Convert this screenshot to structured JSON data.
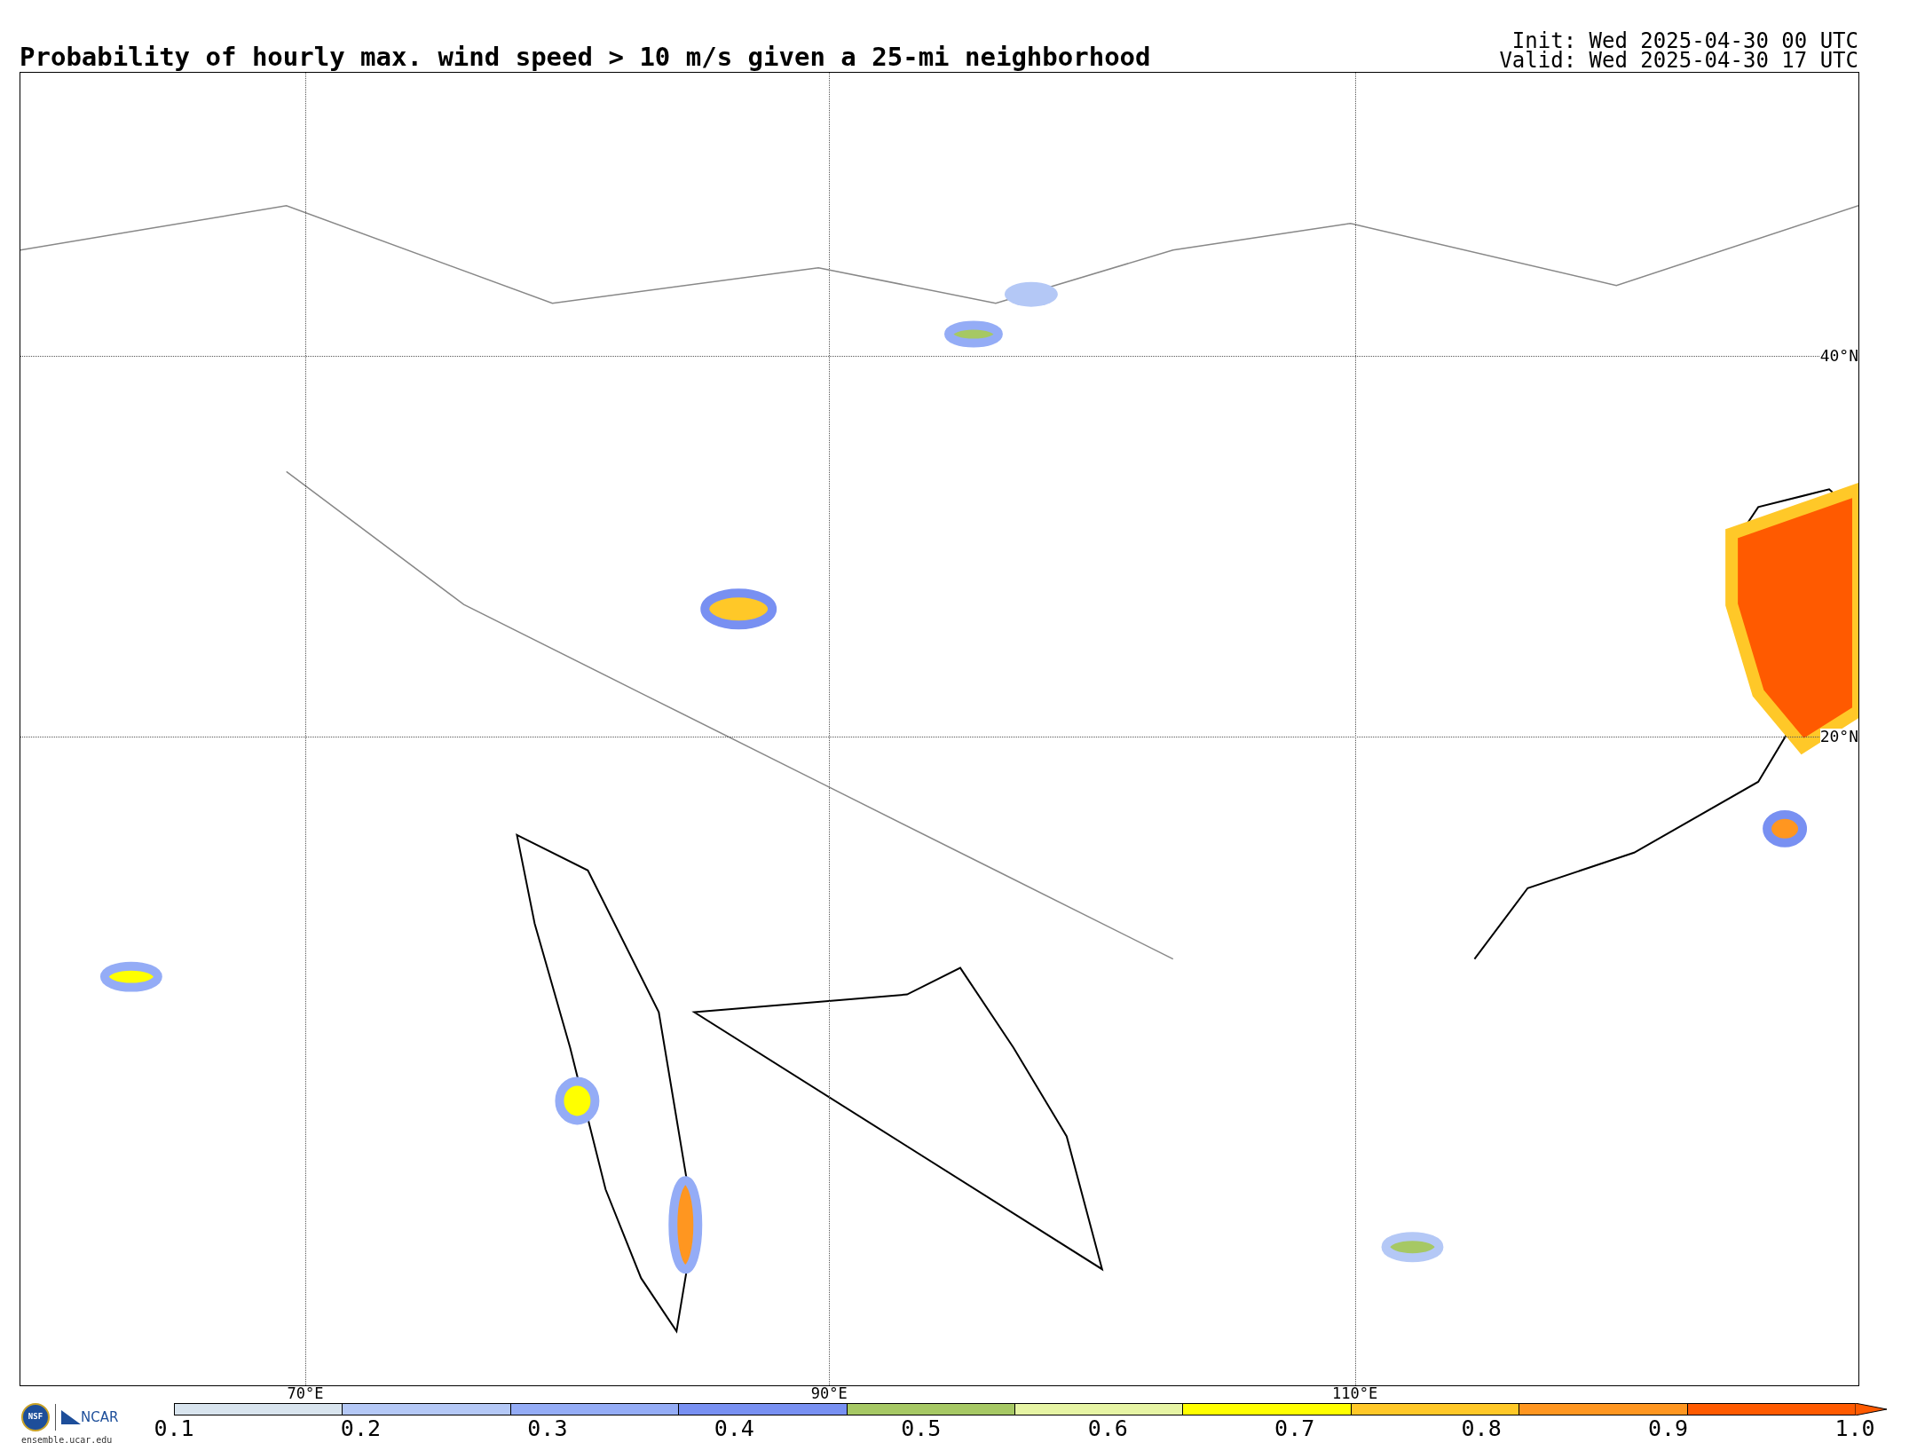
{
  "title": "Probability of hourly max. wind speed > 10 m/s given a 25-mi neighborhood",
  "run_info": [
    "Init: Wed 2025-04-30 00 UTC",
    "Valid: Wed 2025-04-30 17 UTC"
  ],
  "map": {
    "lon_labels": [
      "70°E",
      "90°E",
      "110°E"
    ],
    "lat_labels": [
      "40°N",
      "20°N"
    ]
  },
  "logos": {
    "nsf": "NSF",
    "ncar": "NCAR",
    "url": "ensemble.ucar.edu"
  },
  "colorbar": {
    "segments": [
      {
        "color": "#d8e4ee"
      },
      {
        "color": "#b4c8f6"
      },
      {
        "color": "#94acf6"
      },
      {
        "color": "#7890f2"
      },
      {
        "color": "#a6c864"
      },
      {
        "color": "#e6f4a4"
      },
      {
        "color": "#ffff00"
      },
      {
        "color": "#ffc828"
      },
      {
        "color": "#ff9620"
      },
      {
        "color": "#ff5a00"
      }
    ],
    "ticks": [
      "0.1",
      "0.2",
      "0.3",
      "0.4",
      "0.5",
      "0.6",
      "0.7",
      "0.8",
      "0.9",
      "1.0"
    ]
  }
}
